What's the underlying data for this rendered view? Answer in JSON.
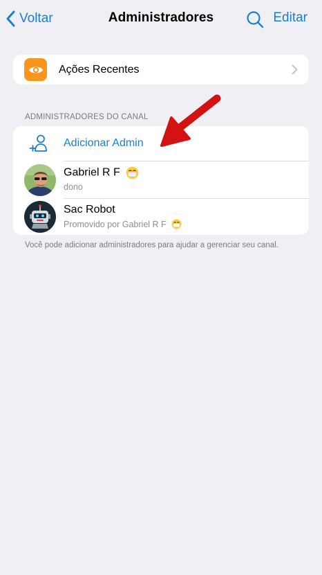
{
  "nav": {
    "back_label": "Voltar",
    "title": "Administradores",
    "search_icon": "search-icon",
    "edit_label": "Editar"
  },
  "recent": {
    "label": "Ações Recentes",
    "icon": "eye-icon"
  },
  "section": {
    "header": "ADMINISTRADORES DO CANAL"
  },
  "admins": {
    "add_label": "Adicionar Admin",
    "items": [
      {
        "name": "Gabriel R F",
        "subtitle": "dono"
      },
      {
        "name": "Sac Robot",
        "subtitle": "Promovido por Gabriel R F"
      }
    ]
  },
  "footer": {
    "text": "Você pode adicionar administradores para ajudar a gerenciar seu canal."
  },
  "colors": {
    "accent": "#1a7fd0",
    "recent_icon_bg": "#f7951e",
    "annotation_arrow": "#d31212",
    "background": "#efeff4"
  }
}
